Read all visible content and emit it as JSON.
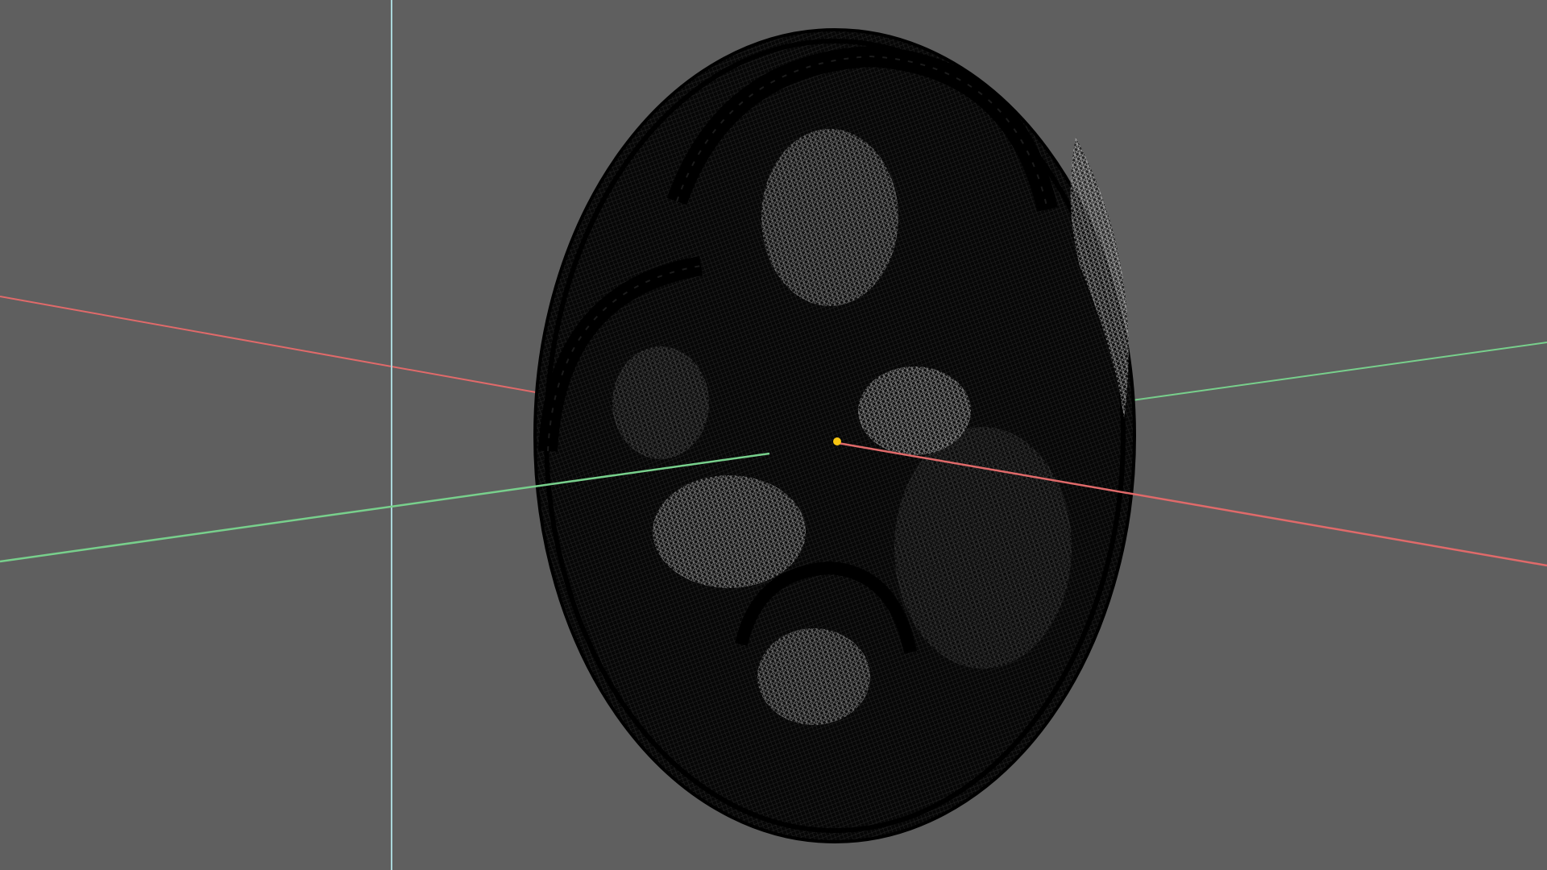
{
  "viewport": {
    "background": "#5f5f5f",
    "mode": "wireframe"
  },
  "model": {
    "shape": "oval relief medallion",
    "mesh_color": "#000000",
    "highlight_color": "#ffffff"
  },
  "axes": {
    "x_axis_color": "#e06a6a",
    "y_axis_color": "#78d08c",
    "z_axis_color": "#a9d6da"
  },
  "pivot": {
    "color": "#f6c512"
  }
}
